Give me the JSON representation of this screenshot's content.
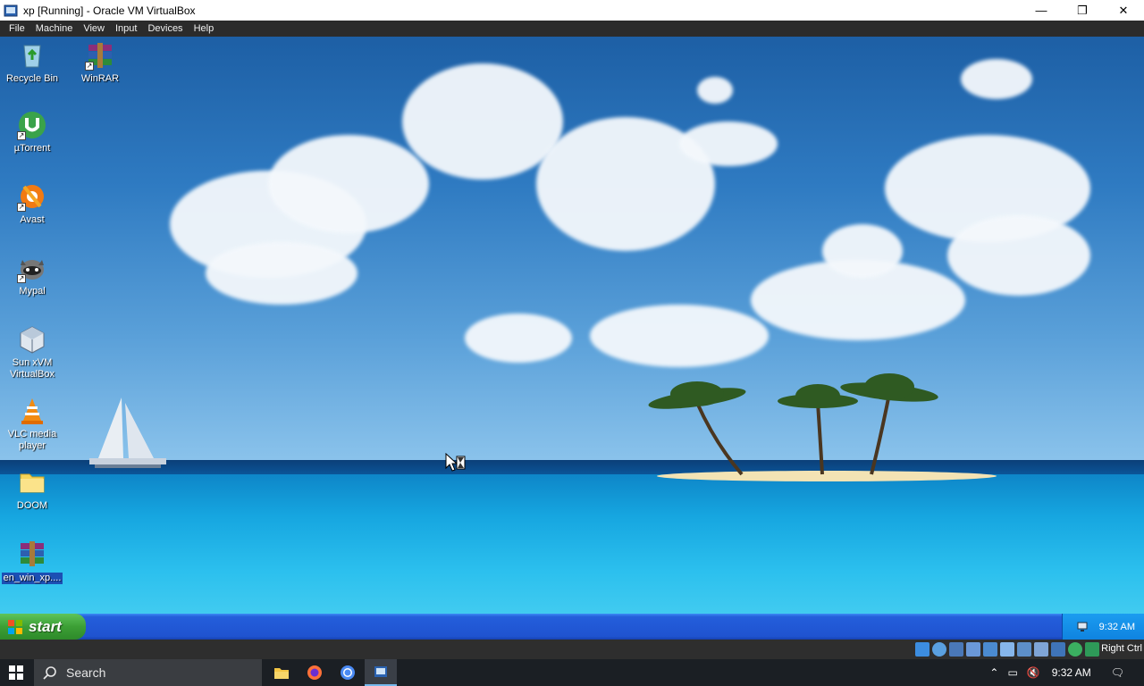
{
  "host_window": {
    "title": "xp [Running] - Oracle VM VirtualBox",
    "controls": {
      "minimize": "—",
      "maximize": "❐",
      "close": "✕"
    }
  },
  "menubar": {
    "items": [
      "File",
      "Machine",
      "View",
      "Input",
      "Devices",
      "Help"
    ]
  },
  "desktop": {
    "icons": [
      {
        "label": "Recycle Bin",
        "icon": "recycle-bin-icon"
      },
      {
        "label": "WinRAR",
        "icon": "winrar-icon"
      },
      {
        "label": "µTorrent",
        "icon": "utorrent-icon"
      },
      {
        "label": "Avast",
        "icon": "avast-icon"
      },
      {
        "label": "Mypal",
        "icon": "mypal-icon"
      },
      {
        "label": "Sun xVM VirtualBox",
        "icon": "virtualbox-icon"
      },
      {
        "label": "VLC media player",
        "icon": "vlc-icon"
      },
      {
        "label": "DOOM",
        "icon": "folder-icon"
      },
      {
        "label": "en_win_xp....",
        "icon": "winrar-archive-icon"
      }
    ]
  },
  "xp_taskbar": {
    "start_label": "start",
    "clock": "9:32 AM"
  },
  "vbox_status": {
    "host_key": "Right Ctrl"
  },
  "host_taskbar": {
    "search_label": "Search",
    "clock": "9:32 AM"
  },
  "colors": {
    "xp_taskbar": "#245edb",
    "start_green": "#3c9f35",
    "vbox_menubar": "#2b2b2b",
    "host_taskbar": "#1b1f24"
  }
}
